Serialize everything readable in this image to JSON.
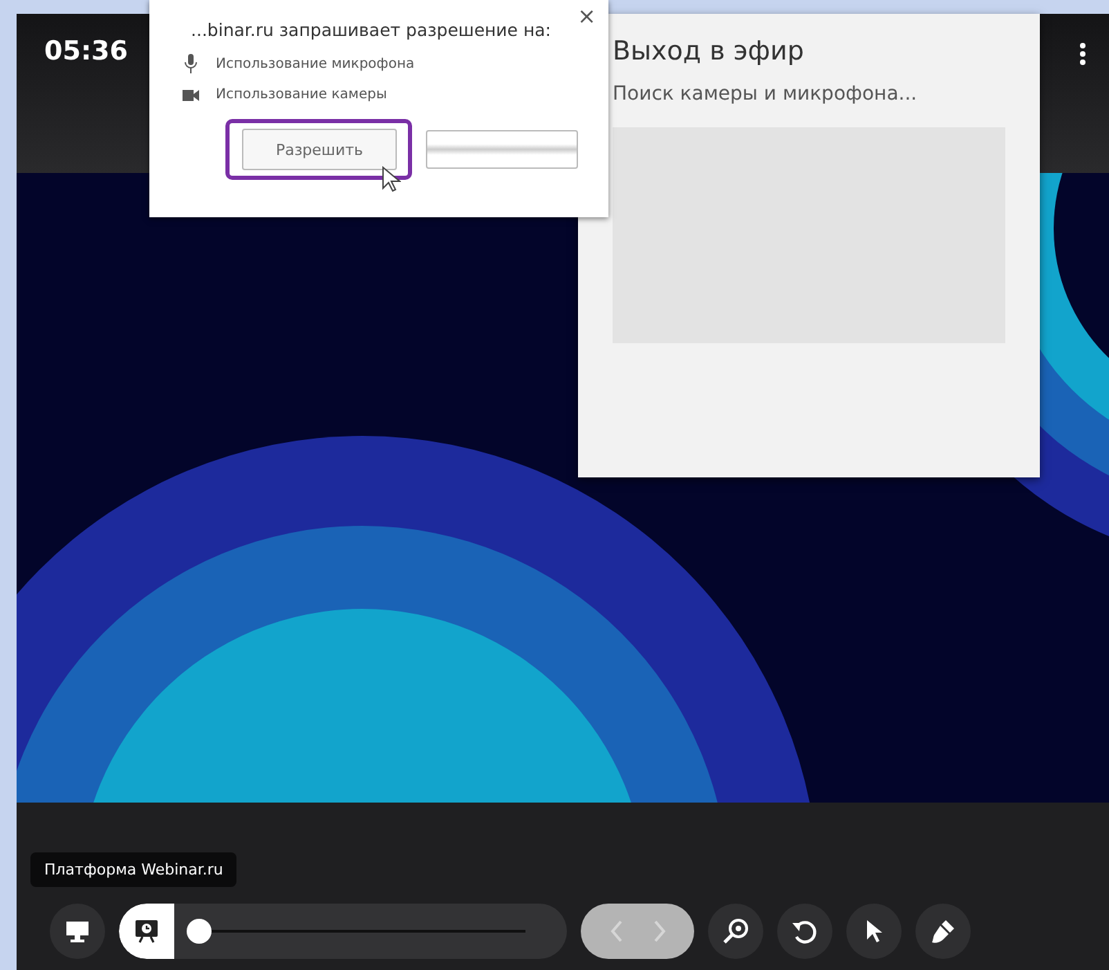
{
  "top_bar": {
    "clock": "05:36"
  },
  "permission_popup": {
    "title": "...binar.ru запрашивает разрешение на:",
    "close": "×",
    "allow_button": "Разрешить",
    "allow_highlighted": true,
    "permissions": [
      {
        "kind": "microphone",
        "label": "Использование микрофона"
      },
      {
        "kind": "camera",
        "label": "Использование камеры"
      }
    ]
  },
  "broadcast_panel": {
    "title": "Выход в эфир",
    "status": "Поиск камеры и микрофона..."
  },
  "tooltip": "Платформа Webinar.ru",
  "toolbar": {
    "slide_progress": {
      "level": 0
    },
    "navigation": {
      "disabled": true
    }
  }
}
